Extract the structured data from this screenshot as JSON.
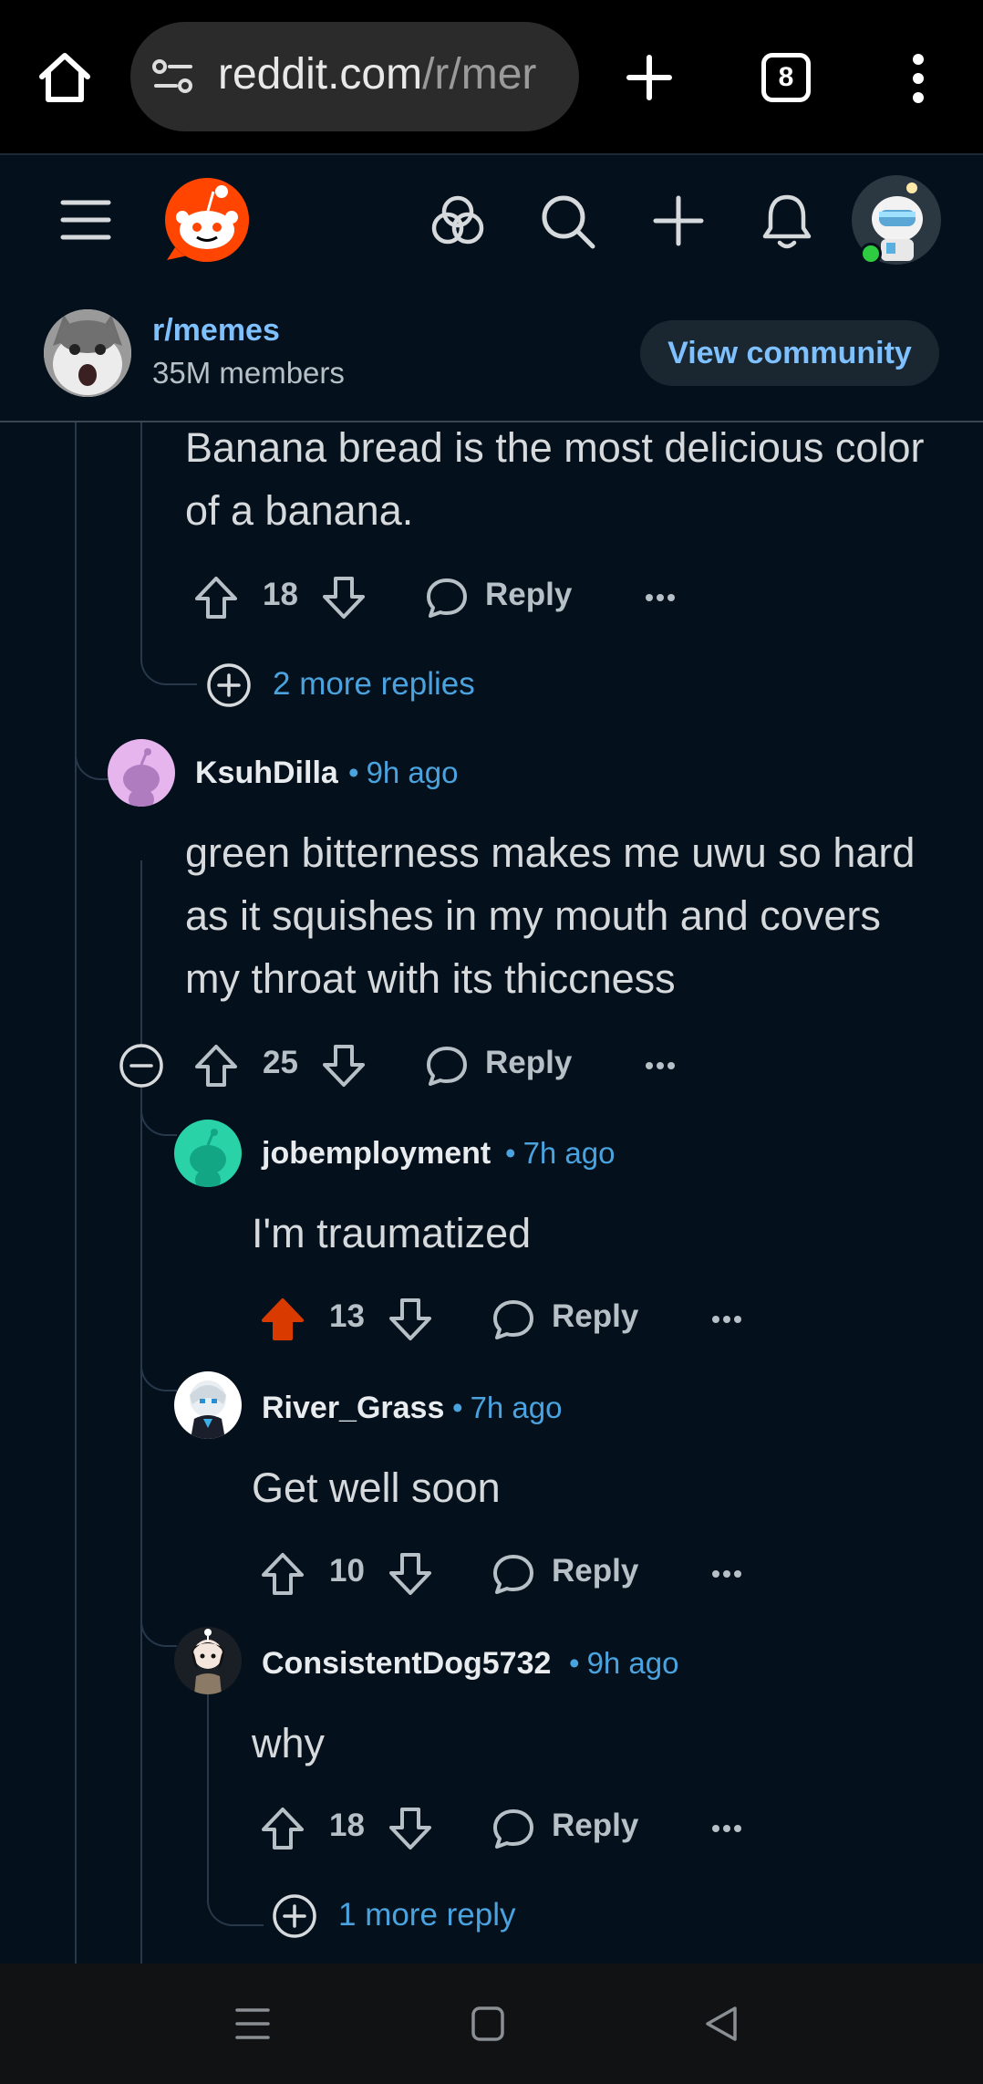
{
  "browser": {
    "url_main": "reddit.com",
    "url_path": "/r/mer",
    "tab_count": "8"
  },
  "community": {
    "name": "r/memes",
    "members": "35M members",
    "view_button": "View community"
  },
  "comments": [
    {
      "id": "c0",
      "body": "Banana bread is the most delicious color of a banana.",
      "score": "18",
      "reply_label": "Reply",
      "more_replies": "2 more replies"
    },
    {
      "id": "c1",
      "username": "KsuhDilla",
      "time": "9h ago",
      "body": "green bitterness makes me uwu so hard as it squishes in my mouth and covers my throat with its thiccness",
      "score": "25",
      "reply_label": "Reply"
    },
    {
      "id": "c2",
      "username": "jobemployment",
      "time": "7h ago",
      "body": "I'm traumatized",
      "score": "13",
      "upvoted": true,
      "reply_label": "Reply"
    },
    {
      "id": "c3",
      "username": "River_Grass",
      "time": "7h ago",
      "body": "Get well soon",
      "score": "10",
      "reply_label": "Reply"
    },
    {
      "id": "c4",
      "username": "ConsistentDog5732",
      "time": "9h ago",
      "body": "why",
      "score": "18",
      "reply_label": "Reply",
      "more_replies": "1 more reply"
    }
  ],
  "colors": {
    "background": "#04101b",
    "link_blue": "#4aa3df",
    "upvote_active": "#d93a00",
    "reddit_orange": "#ff4500"
  }
}
